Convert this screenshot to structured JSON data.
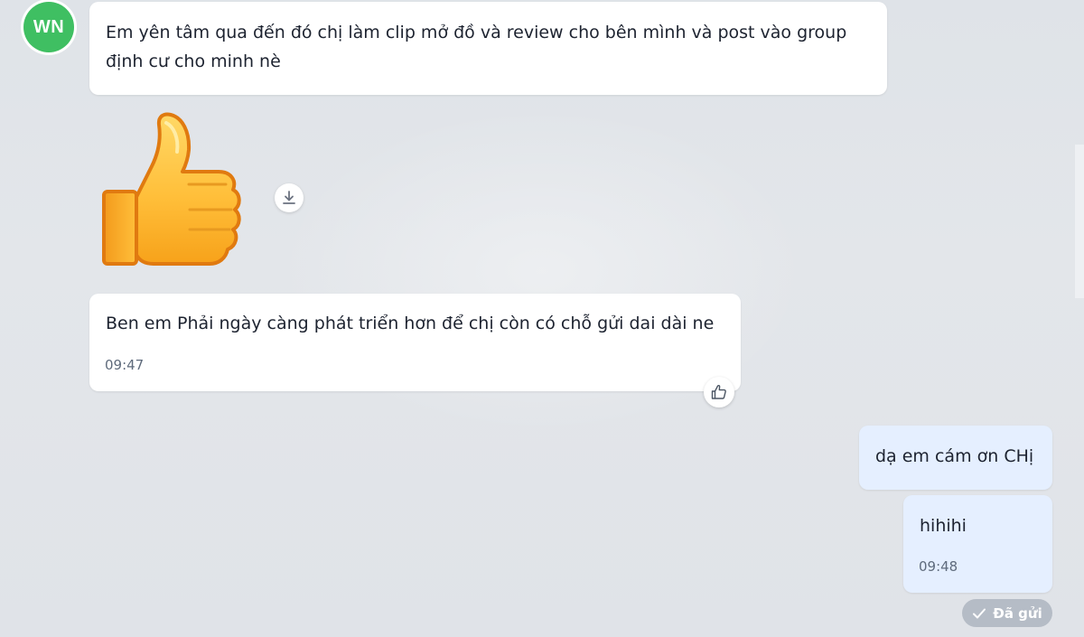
{
  "avatar": {
    "initials": "WN",
    "color": "#3fbf62"
  },
  "messages": [
    {
      "sender": "WN",
      "lines": [
        "Em yên tâm qua đến đó chị làm clip mở đồ và review cho bên mình và post vào group",
        "định cư cho minh nè"
      ]
    },
    {
      "sender": "WN",
      "sticker": "thumbs-up-sticker"
    },
    {
      "sender": "WN",
      "text": "Ben em Phải ngày càng phát triển hơn để chị còn có chỗ gửi dai dài ne",
      "time": "09:47"
    },
    {
      "sender": "me",
      "text": "dạ em cám ơn CHị"
    },
    {
      "sender": "me",
      "text": "hihihi",
      "time": "09:48"
    }
  ],
  "status": {
    "label": "Đã gửi",
    "icon": "check-icon"
  },
  "icons": {
    "download": "download-icon",
    "reaction": "like-icon"
  },
  "colors": {
    "incoming_bubble": "#ffffff",
    "outgoing_bubble": "#e5efff",
    "background": "#dde1e7",
    "status_badge": "#b5bcc6"
  }
}
